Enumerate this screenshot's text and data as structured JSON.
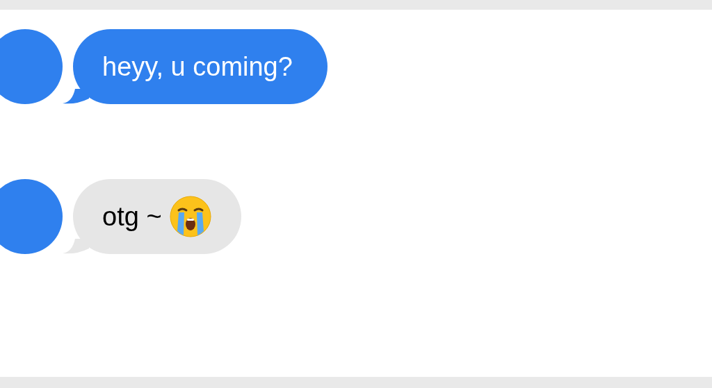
{
  "messages": [
    {
      "kind": "accent",
      "parts": [
        {
          "kind": "text",
          "text": "heyy, u coming?"
        }
      ]
    },
    {
      "kind": "neutral",
      "parts": [
        {
          "kind": "text",
          "text": "otg ~"
        },
        {
          "kind": "emoji"
        }
      ]
    }
  ]
}
